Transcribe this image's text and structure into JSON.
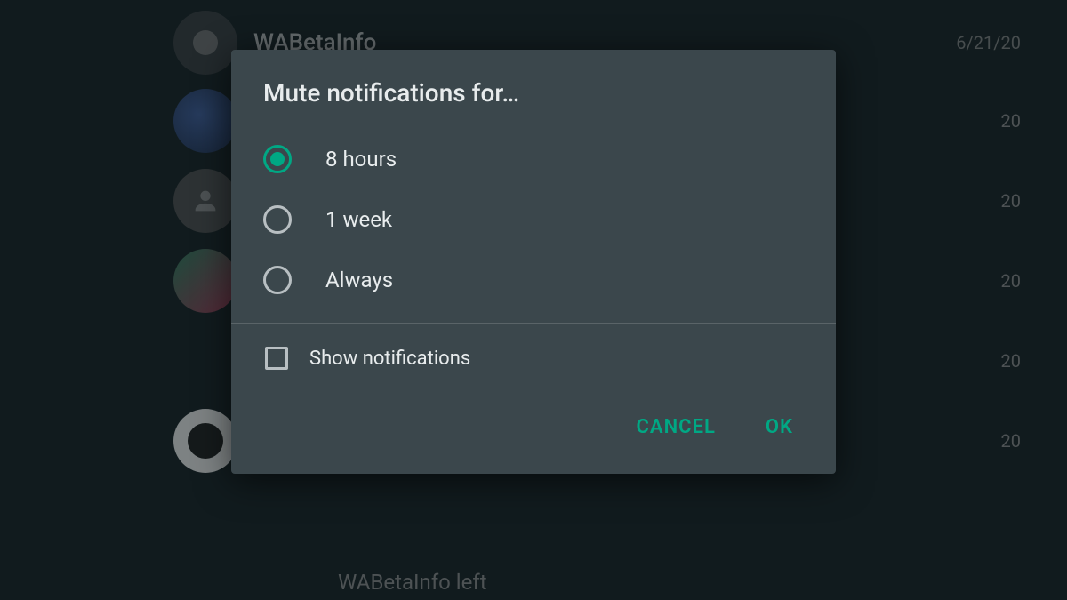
{
  "background": {
    "topChat": {
      "name": "WABetaInfo",
      "date": "6/21/20"
    },
    "dateFragments": [
      "20",
      "20",
      "20",
      "20",
      "20"
    ],
    "bottomText": "WABetaInfo left"
  },
  "dialog": {
    "title": "Mute notifications for…",
    "options": [
      {
        "label": "8 hours",
        "selected": true
      },
      {
        "label": "1 week",
        "selected": false
      },
      {
        "label": "Always",
        "selected": false
      }
    ],
    "checkbox": {
      "label": "Show notifications",
      "checked": false
    },
    "actions": {
      "cancel": "CANCEL",
      "ok": "OK"
    }
  }
}
